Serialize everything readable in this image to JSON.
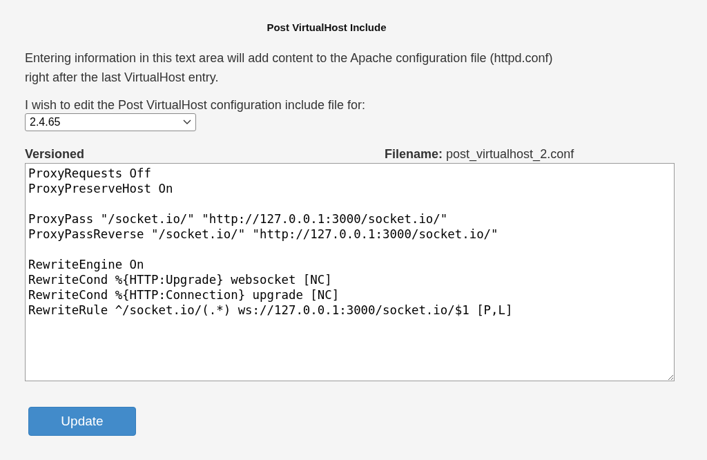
{
  "title": "Post VirtualHost Include",
  "description": "Entering information in this text area will add content to the Apache configuration file (httpd.conf) right after the last VirtualHost entry.",
  "version_select": {
    "label": "I wish to edit the Post VirtualHost configuration include file for:",
    "value": "2.4.65"
  },
  "editor": {
    "heading": "Versioned",
    "filename_label": "Filename:",
    "filename": "post_virtualhost_2.conf",
    "blocks": [
      [
        "ProxyRequests Off",
        "ProxyPreserveHost On"
      ],
      [
        "ProxyPass \"/socket.io/\" \"http://127.0.0.1:3000/socket.io/\"",
        "ProxyPassReverse \"/socket.io/\" \"http://127.0.0.1:3000/socket.io/\""
      ],
      [
        "RewriteEngine On",
        "RewriteCond %{HTTP:Upgrade} websocket [NC]",
        "RewriteCond %{HTTP:Connection} upgrade [NC]",
        "RewriteRule ^/socket.io/(.*) ws://127.0.0.1:3000/socket.io/$1 [P,L]"
      ]
    ]
  },
  "button": "Update"
}
